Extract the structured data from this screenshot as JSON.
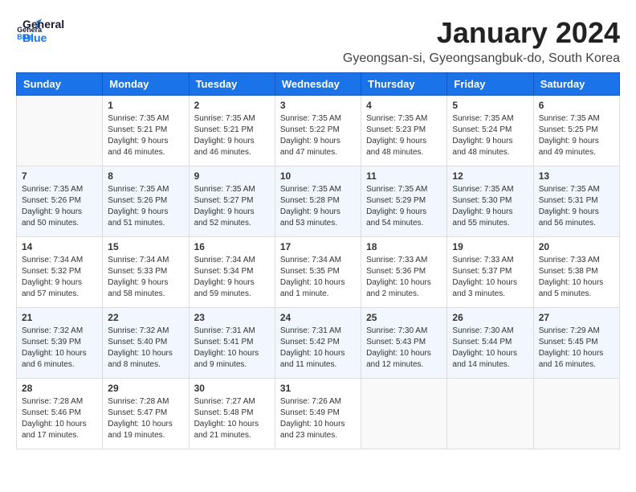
{
  "header": {
    "logo_line1": "General",
    "logo_line2": "Blue",
    "title": "January 2024",
    "location": "Gyeongsan-si, Gyeongsangbuk-do, South Korea"
  },
  "weekdays": [
    "Sunday",
    "Monday",
    "Tuesday",
    "Wednesday",
    "Thursday",
    "Friday",
    "Saturday"
  ],
  "weeks": [
    [
      {
        "day": "",
        "sunrise": "",
        "sunset": "",
        "daylight": "",
        "empty": true
      },
      {
        "day": "1",
        "sunrise": "7:35 AM",
        "sunset": "5:21 PM",
        "daylight": "9 hours and 46 minutes."
      },
      {
        "day": "2",
        "sunrise": "7:35 AM",
        "sunset": "5:21 PM",
        "daylight": "9 hours and 46 minutes."
      },
      {
        "day": "3",
        "sunrise": "7:35 AM",
        "sunset": "5:22 PM",
        "daylight": "9 hours and 47 minutes."
      },
      {
        "day": "4",
        "sunrise": "7:35 AM",
        "sunset": "5:23 PM",
        "daylight": "9 hours and 48 minutes."
      },
      {
        "day": "5",
        "sunrise": "7:35 AM",
        "sunset": "5:24 PM",
        "daylight": "9 hours and 48 minutes."
      },
      {
        "day": "6",
        "sunrise": "7:35 AM",
        "sunset": "5:25 PM",
        "daylight": "9 hours and 49 minutes."
      }
    ],
    [
      {
        "day": "7",
        "sunrise": "7:35 AM",
        "sunset": "5:26 PM",
        "daylight": "9 hours and 50 minutes."
      },
      {
        "day": "8",
        "sunrise": "7:35 AM",
        "sunset": "5:26 PM",
        "daylight": "9 hours and 51 minutes."
      },
      {
        "day": "9",
        "sunrise": "7:35 AM",
        "sunset": "5:27 PM",
        "daylight": "9 hours and 52 minutes."
      },
      {
        "day": "10",
        "sunrise": "7:35 AM",
        "sunset": "5:28 PM",
        "daylight": "9 hours and 53 minutes."
      },
      {
        "day": "11",
        "sunrise": "7:35 AM",
        "sunset": "5:29 PM",
        "daylight": "9 hours and 54 minutes."
      },
      {
        "day": "12",
        "sunrise": "7:35 AM",
        "sunset": "5:30 PM",
        "daylight": "9 hours and 55 minutes."
      },
      {
        "day": "13",
        "sunrise": "7:35 AM",
        "sunset": "5:31 PM",
        "daylight": "9 hours and 56 minutes."
      }
    ],
    [
      {
        "day": "14",
        "sunrise": "7:34 AM",
        "sunset": "5:32 PM",
        "daylight": "9 hours and 57 minutes."
      },
      {
        "day": "15",
        "sunrise": "7:34 AM",
        "sunset": "5:33 PM",
        "daylight": "9 hours and 58 minutes."
      },
      {
        "day": "16",
        "sunrise": "7:34 AM",
        "sunset": "5:34 PM",
        "daylight": "9 hours and 59 minutes."
      },
      {
        "day": "17",
        "sunrise": "7:34 AM",
        "sunset": "5:35 PM",
        "daylight": "10 hours and 1 minute."
      },
      {
        "day": "18",
        "sunrise": "7:33 AM",
        "sunset": "5:36 PM",
        "daylight": "10 hours and 2 minutes."
      },
      {
        "day": "19",
        "sunrise": "7:33 AM",
        "sunset": "5:37 PM",
        "daylight": "10 hours and 3 minutes."
      },
      {
        "day": "20",
        "sunrise": "7:33 AM",
        "sunset": "5:38 PM",
        "daylight": "10 hours and 5 minutes."
      }
    ],
    [
      {
        "day": "21",
        "sunrise": "7:32 AM",
        "sunset": "5:39 PM",
        "daylight": "10 hours and 6 minutes."
      },
      {
        "day": "22",
        "sunrise": "7:32 AM",
        "sunset": "5:40 PM",
        "daylight": "10 hours and 8 minutes."
      },
      {
        "day": "23",
        "sunrise": "7:31 AM",
        "sunset": "5:41 PM",
        "daylight": "10 hours and 9 minutes."
      },
      {
        "day": "24",
        "sunrise": "7:31 AM",
        "sunset": "5:42 PM",
        "daylight": "10 hours and 11 minutes."
      },
      {
        "day": "25",
        "sunrise": "7:30 AM",
        "sunset": "5:43 PM",
        "daylight": "10 hours and 12 minutes."
      },
      {
        "day": "26",
        "sunrise": "7:30 AM",
        "sunset": "5:44 PM",
        "daylight": "10 hours and 14 minutes."
      },
      {
        "day": "27",
        "sunrise": "7:29 AM",
        "sunset": "5:45 PM",
        "daylight": "10 hours and 16 minutes."
      }
    ],
    [
      {
        "day": "28",
        "sunrise": "7:28 AM",
        "sunset": "5:46 PM",
        "daylight": "10 hours and 17 minutes."
      },
      {
        "day": "29",
        "sunrise": "7:28 AM",
        "sunset": "5:47 PM",
        "daylight": "10 hours and 19 minutes."
      },
      {
        "day": "30",
        "sunrise": "7:27 AM",
        "sunset": "5:48 PM",
        "daylight": "10 hours and 21 minutes."
      },
      {
        "day": "31",
        "sunrise": "7:26 AM",
        "sunset": "5:49 PM",
        "daylight": "10 hours and 23 minutes."
      },
      {
        "day": "",
        "sunrise": "",
        "sunset": "",
        "daylight": "",
        "empty": true
      },
      {
        "day": "",
        "sunrise": "",
        "sunset": "",
        "daylight": "",
        "empty": true
      },
      {
        "day": "",
        "sunrise": "",
        "sunset": "",
        "daylight": "",
        "empty": true
      }
    ]
  ],
  "labels": {
    "sunrise_prefix": "Sunrise: ",
    "sunset_prefix": "Sunset: ",
    "daylight_prefix": "Daylight: "
  }
}
